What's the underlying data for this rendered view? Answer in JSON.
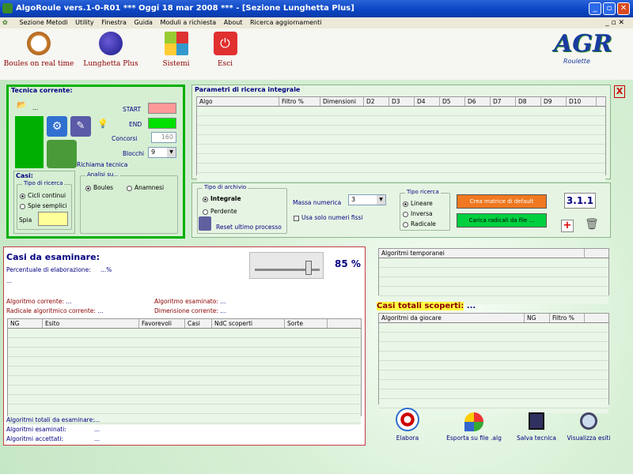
{
  "window": {
    "title": "AlgoRoule vers.1-0-R01  ***  Oggi 18 mar 2008  ***  - [Sezione Lunghetta Plus]"
  },
  "menu": [
    "Sezione Metodi",
    "Utility",
    "Finestra",
    "Guida",
    "Moduli a richiesta",
    "About",
    "Ricerca aggiornamenti"
  ],
  "toolbar": {
    "boules": "Boules on real time",
    "lunghetta": "Lunghetta Plus",
    "sistemi": "Sistemi",
    "esci": "Esci",
    "logo_main": "AGR",
    "logo_sub": "Roulette"
  },
  "tecnica": {
    "title": "Tecnica corrente:",
    "folder_label": "...",
    "start": "START",
    "end": "END",
    "concorsi": "Concorsi",
    "concorsi_value": "160",
    "blocchi": "Blocchi",
    "blocchi_value": "9",
    "richiama": "Richiama tecnica"
  },
  "casi": {
    "title": "Casi:",
    "tipo_ricerca": "Tipo di ricerca",
    "cicli": "Cicli continui",
    "spie": "Spie semplici",
    "spia": "Spia",
    "analisi": "Analisi su...",
    "boules": "Boules",
    "anamnesi": "Anamnesi"
  },
  "parametri": {
    "title": "Parametri di ricerca integrale",
    "columns": [
      "Algo",
      "Filtro %",
      "Dimensioni",
      "D2",
      "D3",
      "D4",
      "D5",
      "D6",
      "D7",
      "D8",
      "D9",
      "D10"
    ]
  },
  "archivio": {
    "title": "Tipo di archivio",
    "integrale": "Integrale",
    "perdente": "Perdente",
    "reset": "Reset ultimo processo",
    "massa": "Massa numerica",
    "massa_value": "3",
    "usa_fissi": "Usa solo numeri fissi",
    "tipo_ricerca": "Tipo ricerca",
    "lineare": "Lineare",
    "inversa": "Inversa",
    "radicale": "Radicale",
    "crea": "Crea matrice di default",
    "carica": "Carica radicali da file ...",
    "version": "3.1.1",
    "add": "+",
    "close": "X"
  },
  "casi_esame": {
    "title": "Casi da esaminare:",
    "percentuale_label": "Percentuale di elaborazione:",
    "percentuale_value": "...%",
    "dots": "...",
    "percent": "85 %",
    "alg_corrente": "Algoritmo corrente:",
    "alg_corrente_v": "...",
    "radicale": "Radicale algoritmico corrente:",
    "radicale_v": "...",
    "alg_esaminato": "Algoritmo esaminato:",
    "alg_esaminato_v": "...",
    "dimensione": "Dimensione corrente:",
    "dimensione_v": "...",
    "columns": [
      "NG",
      "Esito",
      "Favorevoli",
      "Casi",
      "NdC scoperti",
      "Sorte"
    ],
    "totali": "Algoritmi totali da esaminare:",
    "totali_v": "...",
    "esaminati": "Algoritmi esaminati:",
    "esaminati_v": "...",
    "accettati": "Algoritmi accettati:",
    "accettati_v": "..."
  },
  "temporanei": {
    "title": "Algoritmi temporanei"
  },
  "scoperti": {
    "title": "Casi totali scoperti:",
    "value": "...",
    "columns": [
      "Algoritmi da giocare",
      "NG",
      "Filtro %"
    ]
  },
  "actions": {
    "elabora": "Elabora",
    "esporta": "Esporta su file .alg",
    "salva": "Salva tecnica",
    "visualizza": "Visualizza esiti"
  },
  "colors": {
    "title": "#0c46c4",
    "green": "#00c000",
    "pink": "#ff9999",
    "orange": "#f07820",
    "accent": "#000080"
  }
}
